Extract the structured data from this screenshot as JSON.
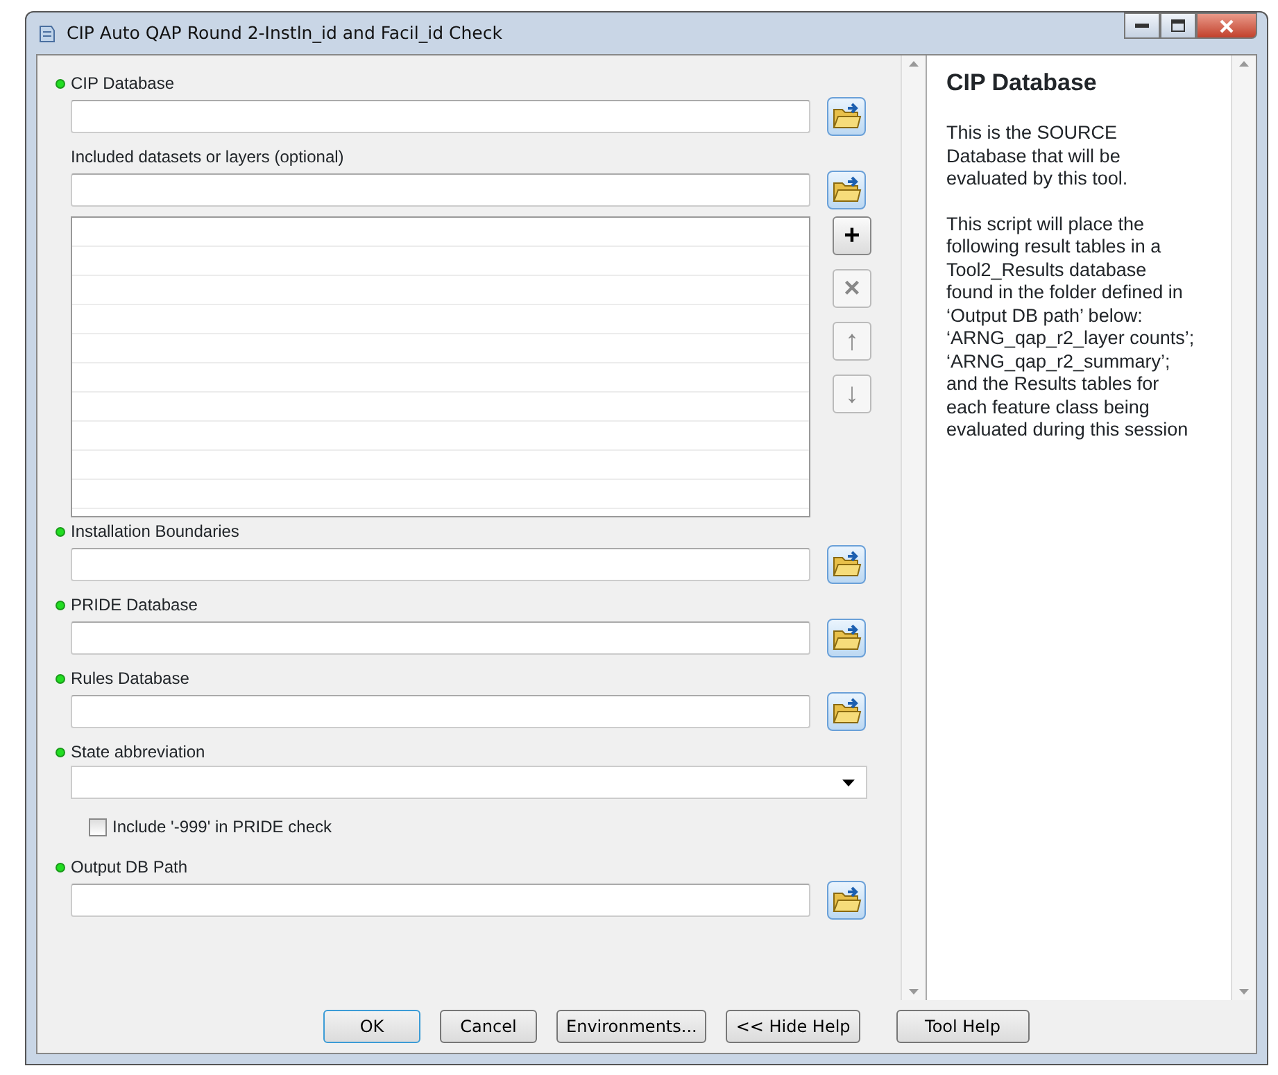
{
  "window": {
    "title": "CIP Auto QAP Round 2-Instln_id and Facil_id Check"
  },
  "parameters": [
    {
      "kind": "path",
      "label": "CIP Database",
      "required": true
    },
    {
      "kind": "path",
      "label": "Included datasets or layers (optional)",
      "required": false
    },
    {
      "kind": "list",
      "list_buttons": [
        "+",
        "×",
        "↑",
        "↓"
      ]
    },
    {
      "kind": "path",
      "label": "Installation Boundaries",
      "required": true
    },
    {
      "kind": "path",
      "label": "PRIDE Database",
      "required": true
    },
    {
      "kind": "path",
      "label": "Rules Database",
      "required": true
    },
    {
      "kind": "dropdown",
      "label": "State abbreviation",
      "required": true
    },
    {
      "kind": "checkbox",
      "label": "Include '-999' in PRIDE check",
      "checked": false
    },
    {
      "kind": "path",
      "label": "Output DB Path",
      "required": true
    }
  ],
  "help": {
    "title": "CIP Database",
    "paragraphs": [
      "This is the SOURCE Database that will be evaluated by this tool.",
      "This script will place the following result tables in a Tool2_Results database found in the folder defined in ‘Output DB path’ below: ‘ARNG_qap_r2_layer counts’; ‘ARNG_qap_r2_summary’; and the Results tables for each feature class being evaluated during this session"
    ]
  },
  "buttons": [
    {
      "label": "OK",
      "default": true
    },
    {
      "label": "Cancel",
      "default": false
    },
    {
      "label": "Environments...",
      "default": false
    },
    {
      "label": "<< Hide Help",
      "default": false
    },
    {
      "label": "Tool Help",
      "default": false
    }
  ]
}
